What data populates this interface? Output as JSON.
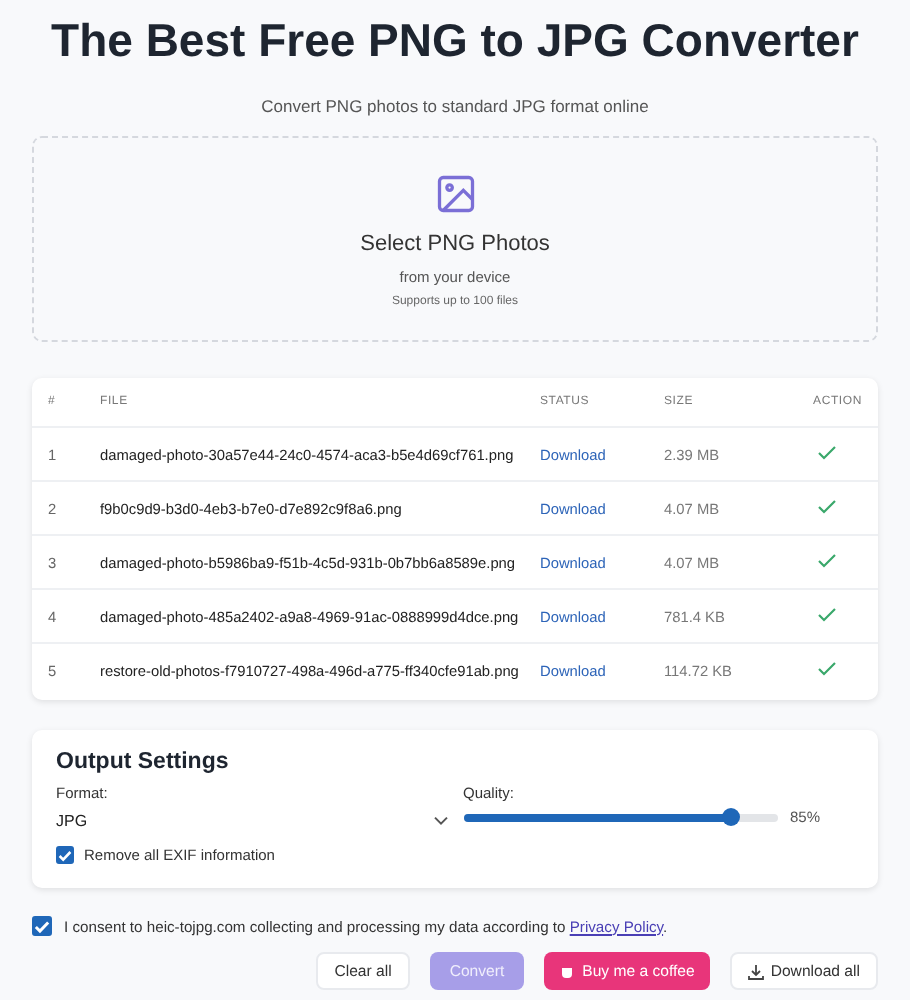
{
  "title": "The Best Free PNG to JPG Converter",
  "subtitle": "Convert PNG photos to standard JPG format online",
  "upload": {
    "title": "Select PNG Photos",
    "subtitle": "from your device",
    "note": "Supports up to 100 files"
  },
  "table": {
    "columns": [
      "#",
      "FILE",
      "STATUS",
      "SIZE",
      "ACTION"
    ],
    "rows": [
      {
        "index": "1",
        "file": "damaged-photo-30a57e44-24c0-4574-aca3-b5e4d69cf761.png",
        "status": "Download",
        "size": "2.39 MB",
        "done": true
      },
      {
        "index": "2",
        "file": "f9b0c9d9-b3d0-4eb3-b7e0-d7e892c9f8a6.png",
        "status": "Download",
        "size": "4.07 MB",
        "done": true
      },
      {
        "index": "3",
        "file": "damaged-photo-b5986ba9-f51b-4c5d-931b-0b7bb6a8589e.png",
        "status": "Download",
        "size": "4.07 MB",
        "done": true
      },
      {
        "index": "4",
        "file": "damaged-photo-485a2402-a9a8-4969-91ac-0888999d4dce.png",
        "status": "Download",
        "size": "781.4 KB",
        "done": true
      },
      {
        "index": "5",
        "file": "restore-old-photos-f7910727-498a-496d-a775-ff340cfe91ab.png",
        "status": "Download",
        "size": "114.72 KB",
        "done": true
      }
    ]
  },
  "settings": {
    "title": "Output Settings",
    "format_label": "Format:",
    "format_value": "JPG",
    "quality_label": "Quality:",
    "quality": {
      "level": 0.85,
      "reading": "85%"
    },
    "exif": {
      "label": "Remove all EXIF information",
      "checked": true
    }
  },
  "consent": {
    "checked": true,
    "text": "I consent to heic-tojpg.com collecting and processing my data according to ",
    "link": "Privacy Policy",
    "after": "."
  },
  "buttons": [
    {
      "kind": "plain",
      "label": "Clear all",
      "disabled": false
    },
    {
      "kind": "primary",
      "label": "Convert",
      "disabled": true
    },
    {
      "kind": "coffee",
      "label": "Buy me a coffee",
      "disabled": false
    },
    {
      "kind": "download",
      "label": "Download all",
      "disabled": false
    }
  ]
}
